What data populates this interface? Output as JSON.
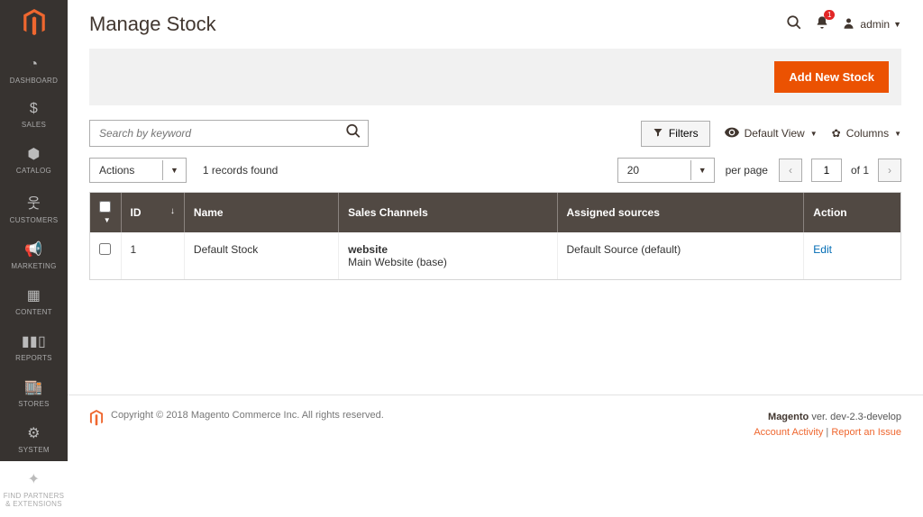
{
  "sidebar": {
    "items": [
      {
        "label": "DASHBOARD"
      },
      {
        "label": "SALES"
      },
      {
        "label": "CATALOG"
      },
      {
        "label": "CUSTOMERS"
      },
      {
        "label": "MARKETING"
      },
      {
        "label": "CONTENT"
      },
      {
        "label": "REPORTS"
      },
      {
        "label": "STORES"
      },
      {
        "label": "SYSTEM"
      },
      {
        "label": "FIND PARTNERS & EXTENSIONS"
      }
    ]
  },
  "header": {
    "title": "Manage Stock",
    "notifications": "1",
    "user": "admin"
  },
  "actions": {
    "add_new_stock": "Add New Stock"
  },
  "controls": {
    "search_placeholder": "Search by keyword",
    "filters": "Filters",
    "default_view": "Default View",
    "columns": "Columns",
    "actions": "Actions",
    "records_found": "1 records found",
    "per_page_value": "20",
    "per_page_label": "per page",
    "page": "1",
    "of_pages": "of 1"
  },
  "table": {
    "headers": {
      "id": "ID",
      "name": "Name",
      "sales_channels": "Sales Channels",
      "assigned_sources": "Assigned sources",
      "action": "Action"
    },
    "rows": [
      {
        "id": "1",
        "name": "Default Stock",
        "channel_type": "website",
        "channel_name": "Main Website (base)",
        "sources": "Default Source (default)",
        "action": "Edit"
      }
    ]
  },
  "footer": {
    "copyright": "Copyright © 2018 Magento Commerce Inc. All rights reserved.",
    "brand": "Magento",
    "version": "ver. dev-2.3-develop",
    "account_activity": "Account Activity",
    "report_issue": "Report an Issue"
  }
}
